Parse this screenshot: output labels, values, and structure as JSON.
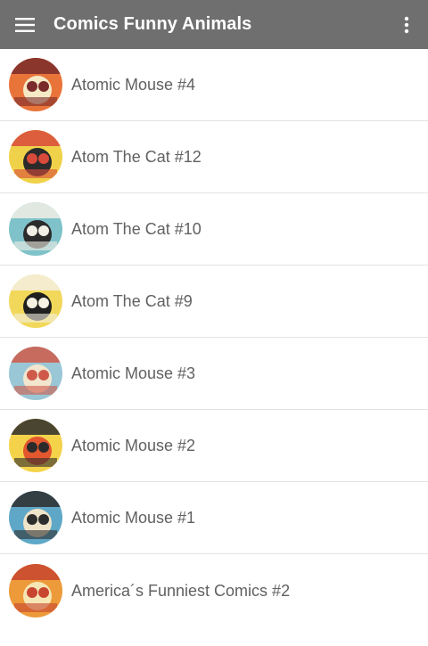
{
  "app": {
    "title": "Comics Funny Animals",
    "menu_icon": "hamburger-menu-icon",
    "overflow_icon": "more-vert-icon"
  },
  "colors": {
    "toolbar": "#6f6f6f",
    "text": "#616161",
    "divider": "#e3e3e3"
  },
  "items": [
    {
      "label": "Atomic Mouse #4",
      "colors": [
        "#e9743a",
        "#f6e9c6",
        "#7a2b2b"
      ]
    },
    {
      "label": "Atom The Cat #12",
      "colors": [
        "#f0d24a",
        "#2b2b2b",
        "#d84a3a"
      ]
    },
    {
      "label": "Atom The Cat #10",
      "colors": [
        "#7fc2c9",
        "#2b2b2b",
        "#f2efe6"
      ]
    },
    {
      "label": "Atom The Cat #9",
      "colors": [
        "#f1d85a",
        "#1f1f1f",
        "#f4f0e2"
      ]
    },
    {
      "label": "Atomic Mouse #3",
      "colors": [
        "#9ac7d6",
        "#f2e6cf",
        "#cf5a4a"
      ]
    },
    {
      "label": "Atomic Mouse #2",
      "colors": [
        "#f4d34b",
        "#e3572f",
        "#2b2b2b"
      ]
    },
    {
      "label": "Atomic Mouse #1",
      "colors": [
        "#5fa7c7",
        "#efe3c9",
        "#2d2d2d"
      ]
    },
    {
      "label": "America´s Funniest Comics #2",
      "colors": [
        "#ec9a3a",
        "#f6e6b5",
        "#c8452f"
      ]
    }
  ]
}
